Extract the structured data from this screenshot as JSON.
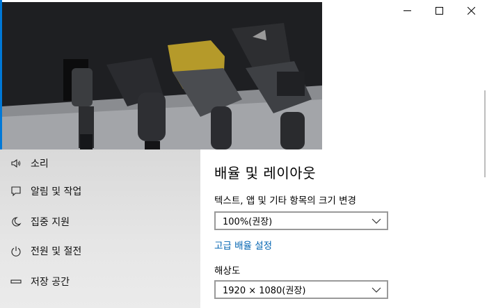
{
  "window": {
    "controls": [
      {
        "name": "minimize-button",
        "icon": "minimize-icon"
      },
      {
        "name": "maximize-button",
        "icon": "maximize-icon"
      },
      {
        "name": "close-button",
        "icon": "close-icon"
      }
    ]
  },
  "sidebar": {
    "items": [
      {
        "label": "소리",
        "icon": "speaker-icon"
      },
      {
        "label": "알림 및 작업",
        "icon": "notification-icon"
      },
      {
        "label": "집중 지원",
        "icon": "moon-icon"
      },
      {
        "label": "전원 및 절전",
        "icon": "power-icon"
      },
      {
        "label": "저장 공간",
        "icon": "storage-icon"
      }
    ]
  },
  "main": {
    "section_title": "배율 및 레이아웃",
    "scale_label": "텍스트, 앱 및 기타 항목의 크기 변경",
    "scale_value": "100%(권장)",
    "advanced_link": "고급 배율 설정",
    "resolution_label": "해상도",
    "resolution_value": "1920 × 1080(권장)"
  },
  "colors": {
    "accent": "#0063b1",
    "sidebar_bg": "#e6e6e6",
    "window_bg": "#ffffff"
  }
}
